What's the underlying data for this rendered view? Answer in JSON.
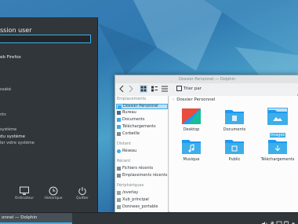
{
  "launcher": {
    "title": "ssion user",
    "search_value": "",
    "items": [
      {
        "label": "eb Firefox",
        "style": "big"
      },
      {
        "label": "ssaké",
        "style": "dim"
      },
      {
        "label": "nts",
        "style": "dim"
      },
      {
        "label": "système",
        "style": "dim"
      },
      {
        "label": "du système",
        "style": "big"
      },
      {
        "label": "ler votre système",
        "style": "dim"
      }
    ],
    "actions": [
      {
        "label": "Ordinateur",
        "icon": "monitor-icon"
      },
      {
        "label": "Historique",
        "icon": "clock-icon"
      },
      {
        "label": "Quitter",
        "icon": "power-icon"
      }
    ]
  },
  "dolphin": {
    "window_title": "Dossier Personnel — Dolphin",
    "toolbar": {
      "split_label": "Trier par"
    },
    "breadcrumb": "Dossier Personnel",
    "sidebar": {
      "sections": [
        {
          "title": "Emplacements",
          "items": [
            {
              "label": "Dossier Personnel",
              "selected": true
            },
            {
              "label": "Bureau"
            },
            {
              "label": "Documents"
            },
            {
              "label": "Téléchargements"
            },
            {
              "label": "Corbeille"
            }
          ]
        },
        {
          "title": "Distant",
          "items": [
            {
              "label": "Réseau"
            }
          ]
        },
        {
          "title": "Récent",
          "items": [
            {
              "label": "Fichiers récents"
            },
            {
              "label": "Emplacements récents"
            }
          ]
        },
        {
          "title": "Périphériques",
          "items": [
            {
              "label": "/overlay"
            },
            {
              "label": "Xub_principal"
            },
            {
              "label": "Donnees_portable"
            }
          ]
        }
      ]
    },
    "files": [
      {
        "name": "Desktop",
        "icon": "desktop-folder-icon",
        "color": "#e74c3c"
      },
      {
        "name": "Documents",
        "icon": "documents-folder-icon",
        "color": "#3daee9"
      },
      {
        "name": "Images",
        "icon": "images-folder-icon",
        "color": "#3daee9",
        "selected": true
      },
      {
        "name": "Musique",
        "icon": "music-folder-icon",
        "color": "#3daee9"
      },
      {
        "name": "Public",
        "icon": "public-folder-icon",
        "color": "#3daee9"
      },
      {
        "name": "Téléchargements",
        "icon": "downloads-folder-icon",
        "color": "#3daee9"
      }
    ]
  },
  "taskbar": {
    "task_label": "onnel — Dolphin",
    "tray_icons": [
      "volume-icon",
      "bluetooth-icon",
      "network-icon",
      "clipboard-icon",
      "expand-tray-icon"
    ]
  },
  "colors": {
    "accent": "#3daee9",
    "panel": "#31363b",
    "window": "#eff0f1"
  }
}
